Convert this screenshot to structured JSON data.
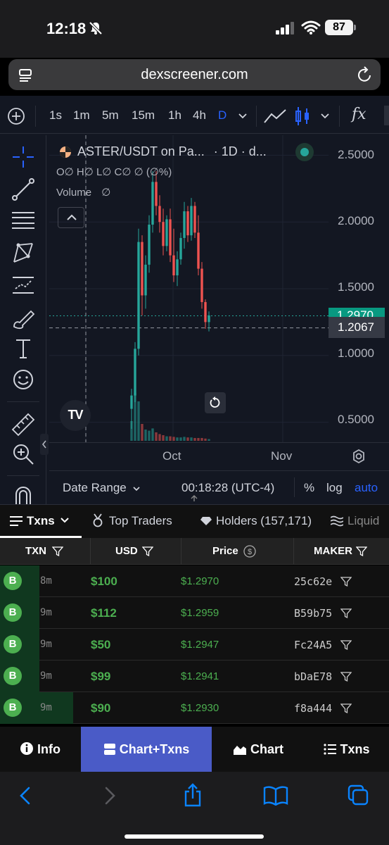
{
  "status_bar": {
    "time": "12:18",
    "battery": "87"
  },
  "browser": {
    "url": "dexscreener.com"
  },
  "chart_toolbar": {
    "timeframes": [
      "1s",
      "1m",
      "5m",
      "15m",
      "1h",
      "4h",
      "D"
    ],
    "active_timeframe": "D",
    "indicator_icon": "fx"
  },
  "chart": {
    "symbol_line": "ASTER/USDT on Pa...",
    "interval_line": "· 1D · d...",
    "ohlc_line": "O∅ H∅ L∅ C∅ ∅ (∅%)",
    "volume_label": "Volume",
    "volume_value": "∅",
    "logo_text": "TV",
    "price_labels": [
      "2.5000",
      "2.0000",
      "1.5000",
      "1.0000",
      "0.5000"
    ],
    "last_price": "1.2970",
    "crosshair_price": "1.2067",
    "time_labels": [
      "Oct",
      "Nov"
    ],
    "date_range_label": "Date Range",
    "clock": "00:18:28 (UTC-4)",
    "percent_label": "%",
    "log_label": "log",
    "auto_label": "auto",
    "colors": {
      "up": "#26a69a",
      "down": "#ef5350",
      "accent": "#2962ff",
      "background": "#131722"
    }
  },
  "chart_data": {
    "type": "candlestick",
    "title": "ASTER/USDT on Pa...",
    "y_axis_ticks": [
      2.5,
      2.0,
      1.5,
      1.0,
      0.5
    ],
    "x_axis_ticks": [
      "Oct",
      "Nov"
    ],
    "ylim": [
      0.35,
      2.65
    ],
    "last_price": 1.297,
    "candles": [
      {
        "o": 0.6,
        "h": 0.75,
        "l": 0.45,
        "c": 0.7,
        "v": 0.35
      },
      {
        "o": 0.7,
        "h": 1.1,
        "l": 0.65,
        "c": 1.05,
        "v": 0.85
      },
      {
        "o": 1.05,
        "h": 1.95,
        "l": 1.0,
        "c": 1.85,
        "v": 0.7
      },
      {
        "o": 1.85,
        "h": 1.9,
        "l": 1.3,
        "c": 1.45,
        "v": 0.3
      },
      {
        "o": 1.45,
        "h": 1.75,
        "l": 1.35,
        "c": 1.68,
        "v": 0.2
      },
      {
        "o": 1.68,
        "h": 2.05,
        "l": 1.62,
        "c": 1.98,
        "v": 0.18
      },
      {
        "o": 1.98,
        "h": 2.38,
        "l": 1.92,
        "c": 2.3,
        "v": 0.22
      },
      {
        "o": 2.3,
        "h": 2.38,
        "l": 2.05,
        "c": 2.12,
        "v": 0.15
      },
      {
        "o": 2.12,
        "h": 2.2,
        "l": 1.92,
        "c": 2.0,
        "v": 0.12
      },
      {
        "o": 2.0,
        "h": 2.1,
        "l": 1.75,
        "c": 1.82,
        "v": 0.1
      },
      {
        "o": 1.82,
        "h": 2.05,
        "l": 1.78,
        "c": 2.02,
        "v": 0.08
      },
      {
        "o": 2.02,
        "h": 2.1,
        "l": 1.7,
        "c": 1.75,
        "v": 0.08
      },
      {
        "o": 1.75,
        "h": 1.95,
        "l": 1.55,
        "c": 1.6,
        "v": 0.07
      },
      {
        "o": 1.6,
        "h": 1.78,
        "l": 1.52,
        "c": 1.72,
        "v": 0.06
      },
      {
        "o": 1.72,
        "h": 1.92,
        "l": 1.68,
        "c": 1.88,
        "v": 0.06
      },
      {
        "o": 1.88,
        "h": 2.15,
        "l": 1.8,
        "c": 2.08,
        "v": 0.07
      },
      {
        "o": 2.08,
        "h": 2.12,
        "l": 1.85,
        "c": 1.9,
        "v": 0.06
      },
      {
        "o": 1.9,
        "h": 2.18,
        "l": 1.86,
        "c": 2.12,
        "v": 0.06
      },
      {
        "o": 2.12,
        "h": 2.15,
        "l": 1.88,
        "c": 1.92,
        "v": 0.05
      },
      {
        "o": 1.92,
        "h": 2.05,
        "l": 1.6,
        "c": 1.65,
        "v": 0.05
      },
      {
        "o": 1.65,
        "h": 1.7,
        "l": 1.35,
        "c": 1.4,
        "v": 0.05
      },
      {
        "o": 1.4,
        "h": 1.42,
        "l": 1.2,
        "c": 1.25,
        "v": 0.04
      },
      {
        "o": 1.25,
        "h": 1.33,
        "l": 1.18,
        "c": 1.3,
        "v": 0.03
      }
    ]
  },
  "tabs": [
    {
      "label": "Txns",
      "icon": "list-icon"
    },
    {
      "label": "Top Traders",
      "icon": "medal-icon"
    },
    {
      "label": "Holders (157,171)",
      "icon": "diamond-icon"
    },
    {
      "label": "Liquid",
      "icon": "waves-icon"
    }
  ],
  "table": {
    "headers": [
      "TXN",
      "USD",
      "Price",
      "MAKER"
    ],
    "rows": [
      {
        "type": "B",
        "age": "8m",
        "usd": "$100",
        "price": "$1.2970",
        "maker": "25c62e"
      },
      {
        "type": "B",
        "age": "9m",
        "usd": "$112",
        "price": "$1.2959",
        "maker": "B59b75"
      },
      {
        "type": "B",
        "age": "9m",
        "usd": "$50",
        "price": "$1.2947",
        "maker": "Fc24A5"
      },
      {
        "type": "B",
        "age": "9m",
        "usd": "$99",
        "price": "$1.2941",
        "maker": "bDaE78"
      },
      {
        "type": "B",
        "age": "9m",
        "usd": "$90",
        "price": "$1.2930",
        "maker": "f8a444"
      }
    ]
  },
  "view_switcher": {
    "info": "Info",
    "chart_txns": "Chart+Txns",
    "chart": "Chart",
    "txns": "Txns",
    "active": "Chart+Txns"
  }
}
